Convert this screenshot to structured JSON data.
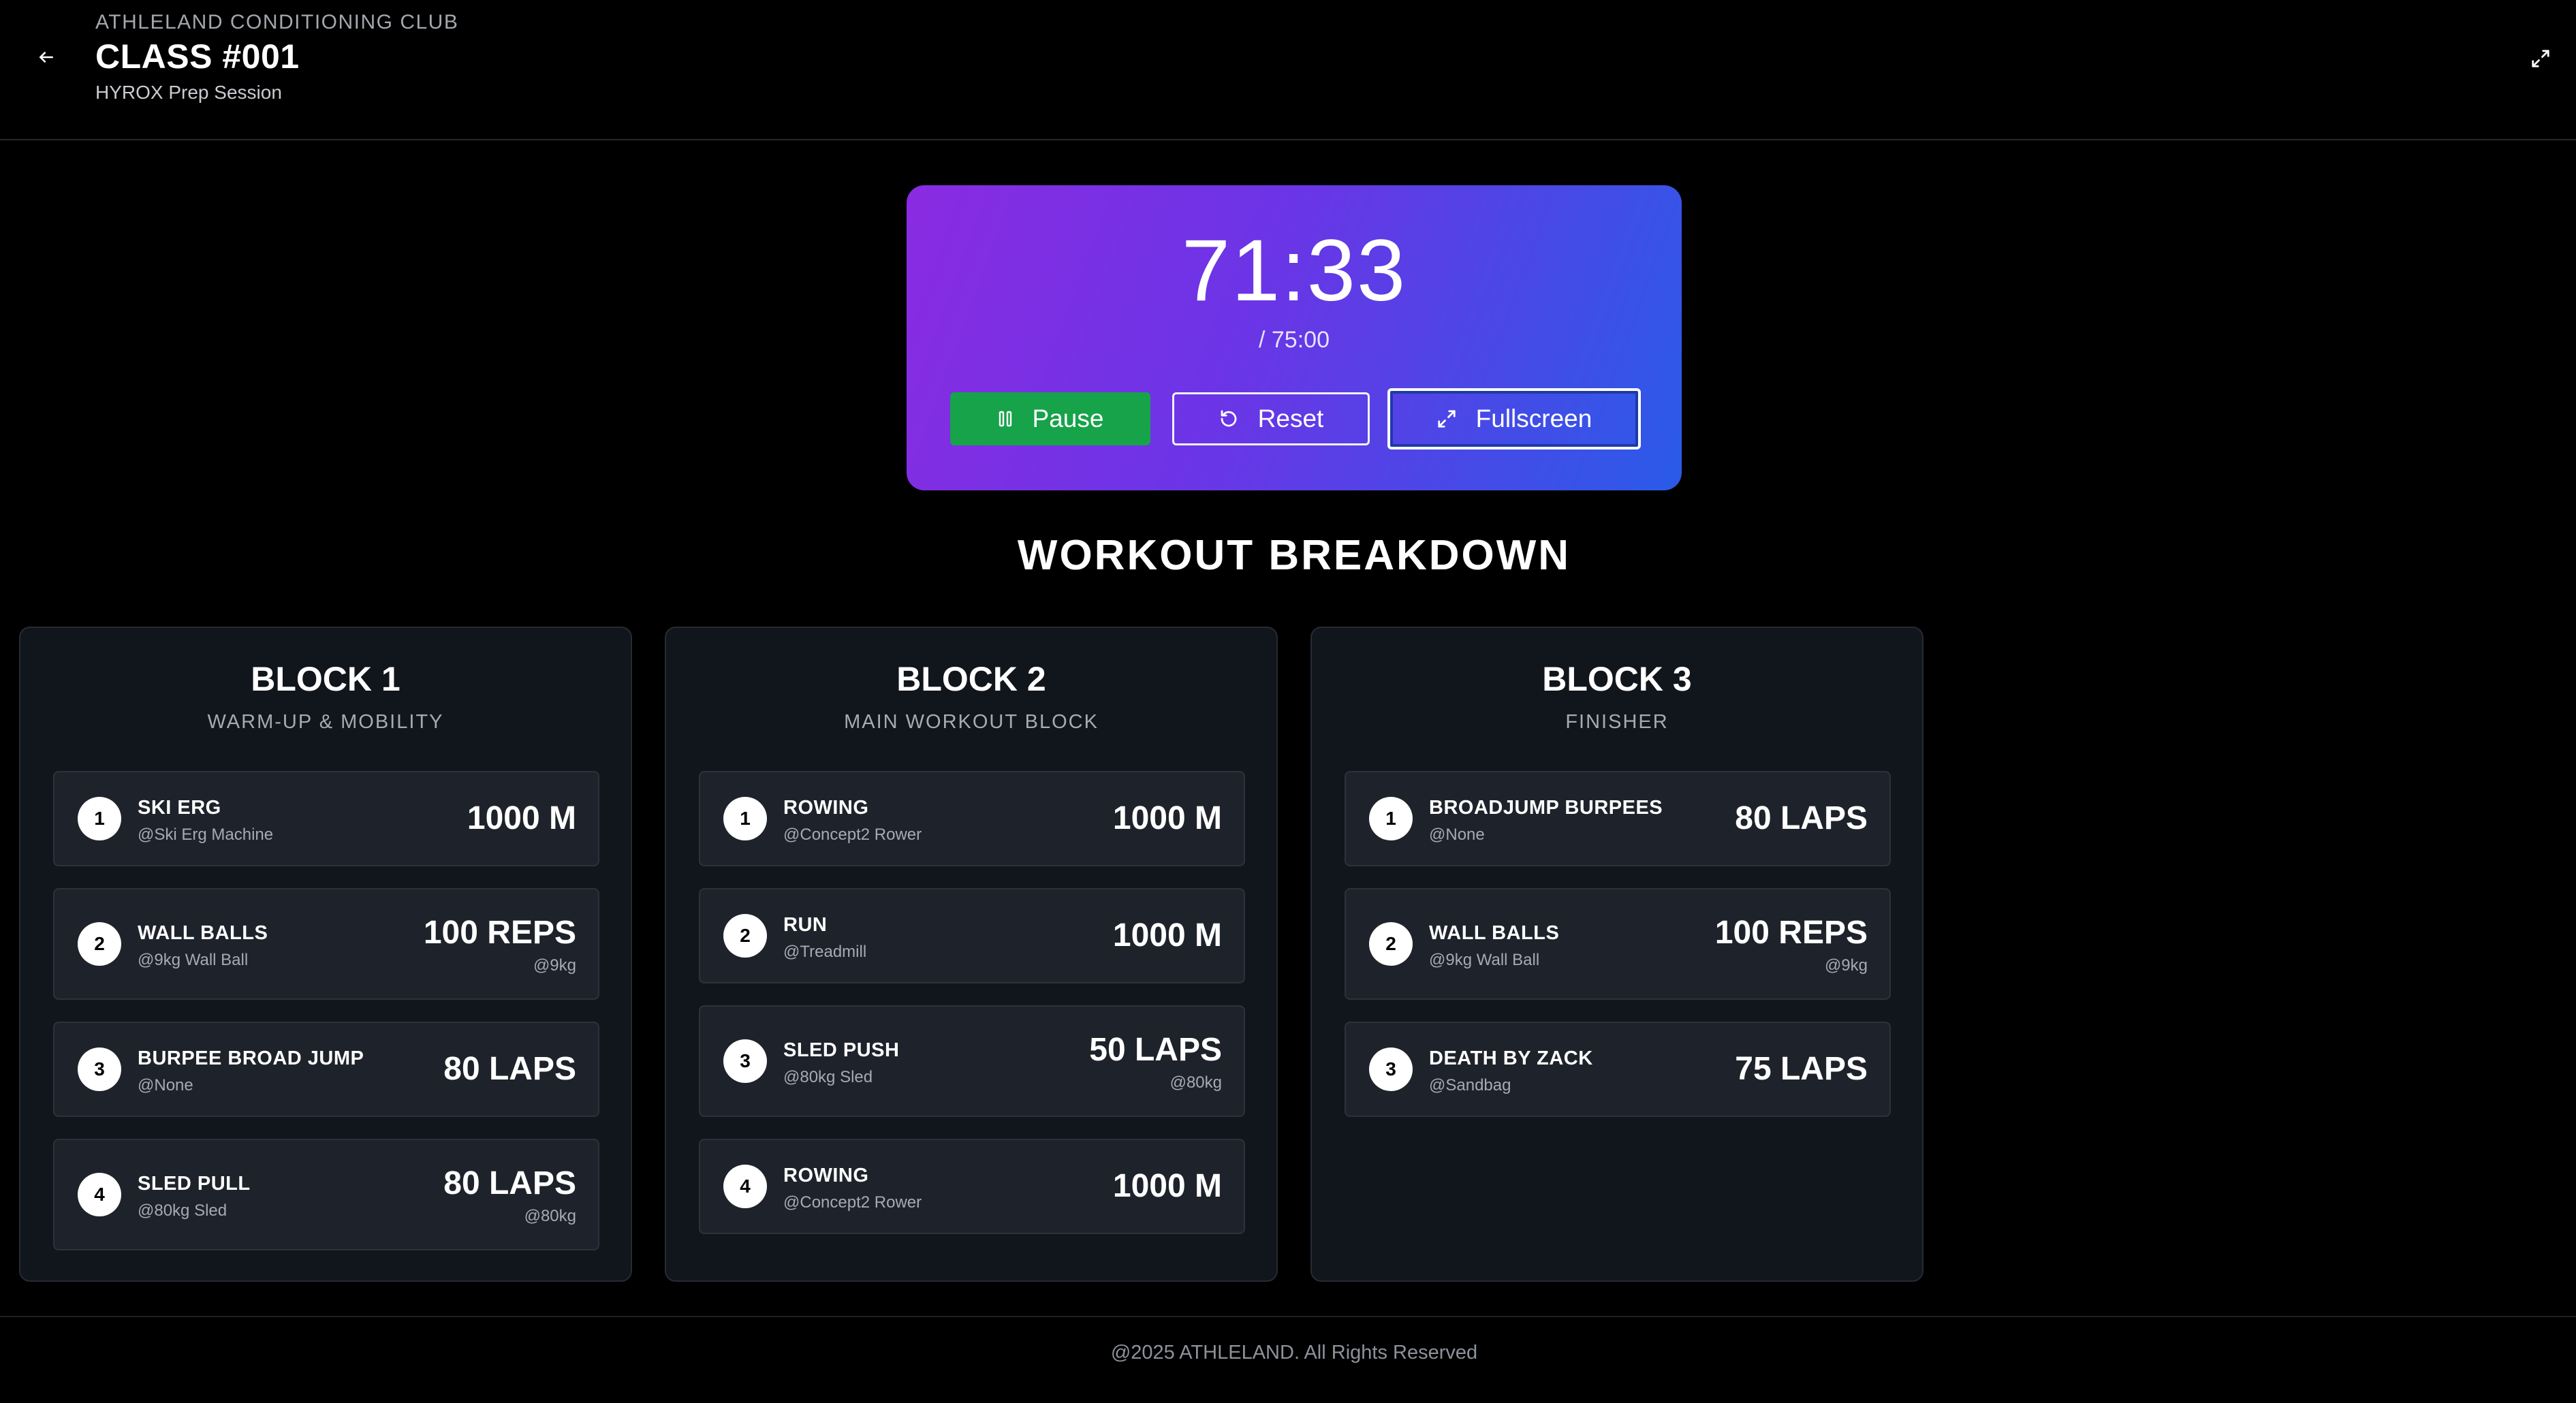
{
  "header": {
    "club_name": "ATHLELAND CONDITIONING CLUB",
    "class_title": "CLASS #001",
    "class_subtitle": "HYROX Prep Session",
    "back_icon": "arrow-left-icon",
    "expand_icon": "expand-icon"
  },
  "timer": {
    "elapsed": "71:33",
    "total": "/ 75:00",
    "gradient_start": "#8a2be2",
    "gradient_end": "#2a5be8",
    "buttons": {
      "pause": {
        "label": "Pause",
        "icon": "pause-icon",
        "color": "#16a34a"
      },
      "reset": {
        "label": "Reset",
        "icon": "reset-icon"
      },
      "fullscreen": {
        "label": "Fullscreen",
        "icon": "expand-icon"
      }
    }
  },
  "section_title": "WORKOUT BREAKDOWN",
  "blocks": [
    {
      "title": "BLOCK 1",
      "subtitle": "WARM-UP & MOBILITY",
      "exercises": [
        {
          "num": "1",
          "name": "SKI ERG",
          "equipment": "@Ski Erg Machine",
          "amount": "1000 M",
          "weight": ""
        },
        {
          "num": "2",
          "name": "WALL BALLS",
          "equipment": "@9kg Wall Ball",
          "amount": "100 REPS",
          "weight": "@9kg"
        },
        {
          "num": "3",
          "name": "BURPEE BROAD JUMP",
          "equipment": "@None",
          "amount": "80 LAPS",
          "weight": ""
        },
        {
          "num": "4",
          "name": "SLED PULL",
          "equipment": "@80kg Sled",
          "amount": "80 LAPS",
          "weight": "@80kg"
        }
      ]
    },
    {
      "title": "BLOCK 2",
      "subtitle": "MAIN WORKOUT BLOCK",
      "exercises": [
        {
          "num": "1",
          "name": "ROWING",
          "equipment": "@Concept2 Rower",
          "amount": "1000 M",
          "weight": ""
        },
        {
          "num": "2",
          "name": "RUN",
          "equipment": "@Treadmill",
          "amount": "1000 M",
          "weight": ""
        },
        {
          "num": "3",
          "name": "SLED PUSH",
          "equipment": "@80kg Sled",
          "amount": "50 LAPS",
          "weight": "@80kg"
        },
        {
          "num": "4",
          "name": "ROWING",
          "equipment": "@Concept2 Rower",
          "amount": "1000 M",
          "weight": ""
        }
      ]
    },
    {
      "title": "BLOCK 3",
      "subtitle": "FINISHER",
      "exercises": [
        {
          "num": "1",
          "name": "BROADJUMP BURPEES",
          "equipment": "@None",
          "amount": "80 LAPS",
          "weight": ""
        },
        {
          "num": "2",
          "name": "WALL BALLS",
          "equipment": "@9kg Wall Ball",
          "amount": "100 REPS",
          "weight": "@9kg"
        },
        {
          "num": "3",
          "name": "DEATH BY ZACK",
          "equipment": "@Sandbag",
          "amount": "75 LAPS",
          "weight": ""
        }
      ]
    }
  ],
  "footer": {
    "text": "@2025 ATHLELAND. All Rights Reserved"
  }
}
